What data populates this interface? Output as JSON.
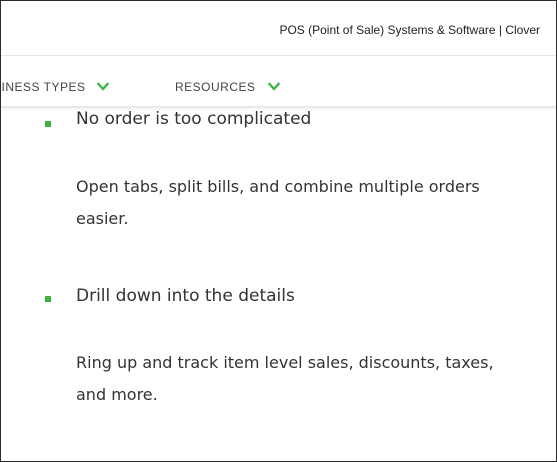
{
  "window": {
    "title": "POS (Point of Sale) Systems & Software | Clover"
  },
  "nav": {
    "items": [
      {
        "label": "SINESS TYPES",
        "icon": "chevron-down-icon"
      },
      {
        "label": "RESOURCES",
        "icon": "chevron-down-icon"
      }
    ]
  },
  "features": [
    {
      "heading": "No order is too complicated",
      "description": "Open tabs, split bills, and combine multiple orders easier."
    },
    {
      "heading": "Drill down into the details",
      "description": "Ring up and track item level sales, discounts, taxes, and more."
    }
  ],
  "colors": {
    "accent": "#3bb54a",
    "text": "#333333"
  }
}
